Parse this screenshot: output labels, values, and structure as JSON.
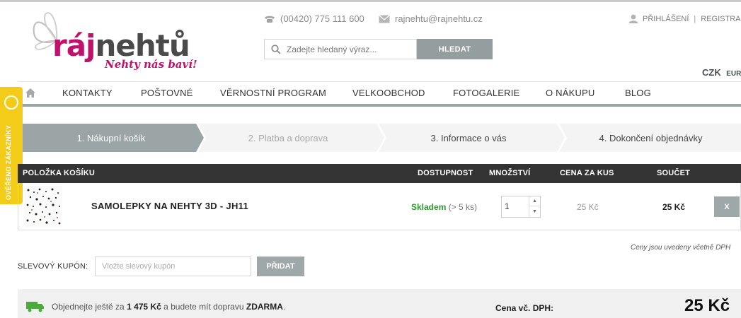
{
  "brand": {
    "logo_part1": "ráj",
    "logo_part2": "nehtů",
    "tagline": "Nehty nás baví!",
    "color_pink": "#c0126b"
  },
  "contact": {
    "phone": "(00420) 775 111 600",
    "email": "rajnehtu@rajnehtu.cz"
  },
  "search": {
    "placeholder": "Zadejte hledaný výraz...",
    "button_label": "HLEDAT"
  },
  "account": {
    "login": "PŘIHLÁŠENÍ",
    "register": "REGISTRACE"
  },
  "currency": {
    "active": "CZK",
    "other": "EUR"
  },
  "nav": {
    "items": [
      "KONTAKTY",
      "POŠTOVNÉ",
      "VĚRNOSTNÍ PROGRAM",
      "VELKOOBCHOD",
      "FOTOGALERIE",
      "O NÁKUPU",
      "BLOG"
    ]
  },
  "badge": {
    "text": "OVĚŘENO ZÁKAZNÍKY"
  },
  "steps": [
    {
      "label": "1. Nákupní košík",
      "active": true
    },
    {
      "label": "2. Platba a doprava",
      "active": false
    },
    {
      "label": "3. Informace o vás",
      "active": false
    },
    {
      "label": "4. Dokončení objednávky",
      "active": false
    }
  ],
  "cart": {
    "headers": {
      "item": "POLOŽKA KOŠÍKU",
      "availability": "DOSTUPNOST",
      "quantity": "MNOŽSTVÍ",
      "unit_price": "CENA ZA KUS",
      "total": "SOUČET"
    },
    "items": [
      {
        "name": "SAMOLEPKY NA NEHTY 3D - JH11",
        "availability": "Skladem",
        "availability_note": "(> 5 ks)",
        "quantity": "1",
        "unit_price": "25 Kč",
        "total": "25 Kč",
        "remove_label": "X"
      }
    ],
    "vat_note": "Ceny jsou uvedeny včetně DPH"
  },
  "coupon": {
    "label": "SLEVOVÝ KUPÓN:",
    "placeholder": "Vložte slevový kupón",
    "button_label": "PŘIDAT"
  },
  "summary": {
    "shipping_prefix": "Objednejte ještě za",
    "shipping_amount": "1 475 Kč",
    "shipping_middle": "a budete mít dopravu",
    "shipping_free": "ZDARMA",
    "shipping_suffix": ".",
    "total_label": "Cena vč. DPH:",
    "total_value": "25 Kč"
  },
  "colors": {
    "accent_gray": "#9ba5a5",
    "available_green": "#2a9a2a",
    "badge_yellow": "#f2cc19"
  }
}
